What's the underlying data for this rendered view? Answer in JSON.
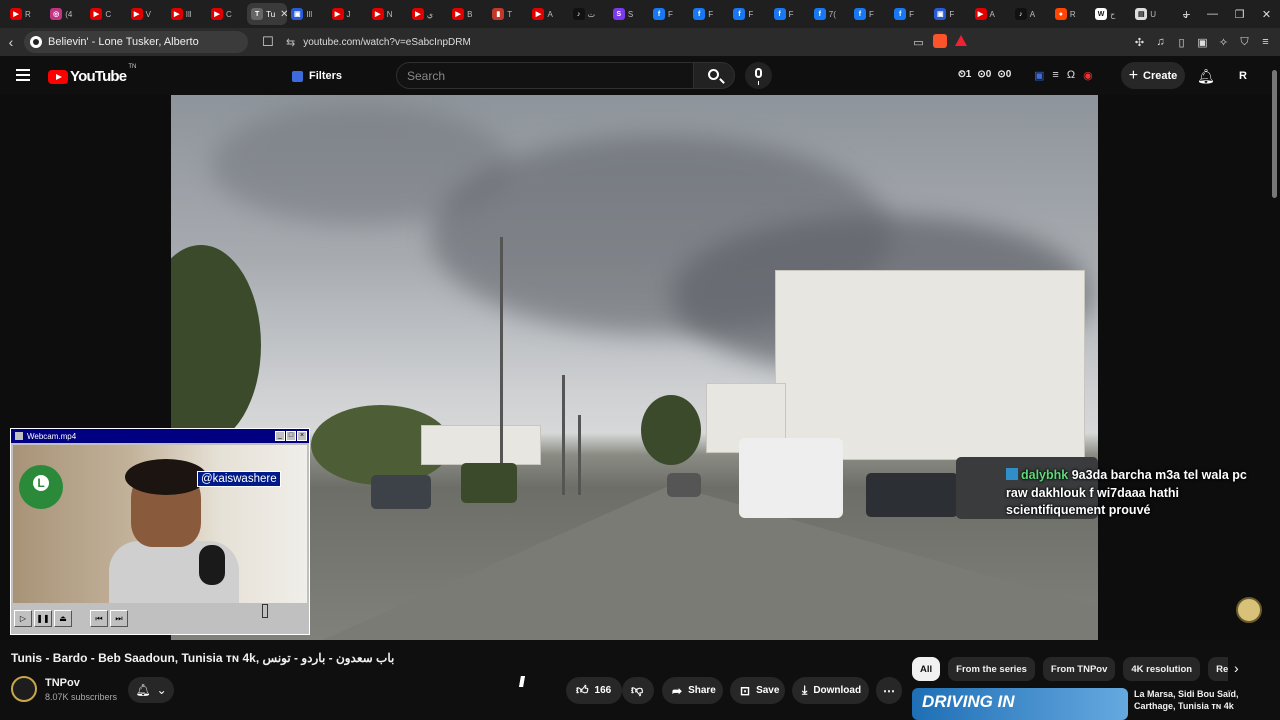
{
  "browser": {
    "tabs": [
      {
        "label": "R",
        "color": "#e00000",
        "glyph": "▶"
      },
      {
        "label": "(4",
        "color": "#c13584",
        "glyph": "◎"
      },
      {
        "label": "C",
        "color": "#e00000",
        "glyph": "▶"
      },
      {
        "label": "V",
        "color": "#e00000",
        "glyph": "▶"
      },
      {
        "label": "Ill",
        "color": "#e00000",
        "glyph": "▶"
      },
      {
        "label": "C",
        "color": "#e00000",
        "glyph": "▶"
      },
      {
        "label": "Tu",
        "color": "#666666",
        "glyph": "T",
        "active": true
      },
      {
        "label": "Ill",
        "color": "#2a5bd7",
        "glyph": "▣"
      },
      {
        "label": "J",
        "color": "#e00000",
        "glyph": "▶"
      },
      {
        "label": "N",
        "color": "#e00000",
        "glyph": "▶"
      },
      {
        "label": "ي",
        "color": "#e00000",
        "glyph": "▶"
      },
      {
        "label": "B",
        "color": "#e00000",
        "glyph": "▶"
      },
      {
        "label": "T",
        "color": "#c0392b",
        "glyph": "▮"
      },
      {
        "label": "A",
        "color": "#e00000",
        "glyph": "▶"
      },
      {
        "label": "ت",
        "color": "#111111",
        "glyph": "♪"
      },
      {
        "label": "S",
        "color": "#7c3aed",
        "glyph": "S"
      },
      {
        "label": "F",
        "color": "#1877f2",
        "glyph": "f"
      },
      {
        "label": "F",
        "color": "#1877f2",
        "glyph": "f"
      },
      {
        "label": "F",
        "color": "#1877f2",
        "glyph": "f"
      },
      {
        "label": "F",
        "color": "#1877f2",
        "glyph": "f"
      },
      {
        "label": "7(",
        "color": "#1877f2",
        "glyph": "f"
      },
      {
        "label": "F",
        "color": "#1877f2",
        "glyph": "f"
      },
      {
        "label": "F",
        "color": "#1877f2",
        "glyph": "f"
      },
      {
        "label": "F",
        "color": "#2a5bd7",
        "glyph": "▣"
      },
      {
        "label": "A",
        "color": "#e00000",
        "glyph": "▶"
      },
      {
        "label": "A",
        "color": "#111111",
        "glyph": "♪"
      },
      {
        "label": "R",
        "color": "#ff4500",
        "glyph": "●"
      },
      {
        "label": "ح",
        "color": "#ffffff",
        "glyph": "W"
      },
      {
        "label": "U",
        "color": "#dddddd",
        "glyph": "▤"
      }
    ],
    "new_tab": "+",
    "tab_close": "✕",
    "window_controls": {
      "dropdown": "⌄",
      "minimize": "—",
      "restore": "❐",
      "close": "✕"
    },
    "back": "‹",
    "media_title": "Believin' - Lone Tusker, Alberto",
    "url": "youtube.com/watch?v=eSabcInpDRM",
    "url_prefix_icon": "⇆",
    "bookmark_icon": "☐"
  },
  "youtube": {
    "logo_text": "YouTube",
    "logo_suffix": "TN",
    "filters_label": "Filters",
    "search_placeholder": "Search",
    "stats": [
      "⏲1",
      "⊙0",
      "⊙0"
    ],
    "create_label": "Create",
    "avatar_letter": "R"
  },
  "overlay": {
    "chat_user": "dalybhk",
    "chat_message": "9a3da barcha m3a tel wala pc raw dakhlouk f wi7daaa hathi scientifiquement prouvé",
    "webcam_title": "Webcam.mp4",
    "webcam_handle": "@kaiswashere"
  },
  "video": {
    "title": "Tunis - Bardo - Beb Saadoun, Tunisia ᴛɴ 4k, باب سعدون - باردو - تونس",
    "channel": "TNPov",
    "subscribers": "8.07K subscribers",
    "likes": "166",
    "share_label": "Share",
    "save_label": "Save",
    "download_label": "Download"
  },
  "chips": [
    "All",
    "From the series",
    "From TNPov",
    "4K resolution",
    "Related"
  ],
  "recommendation": {
    "thumb_text": "DRIVING IN",
    "title": "La Marsa, Sidi Bou Saïd, Carthage, Tunisia ᴛɴ 4k"
  }
}
